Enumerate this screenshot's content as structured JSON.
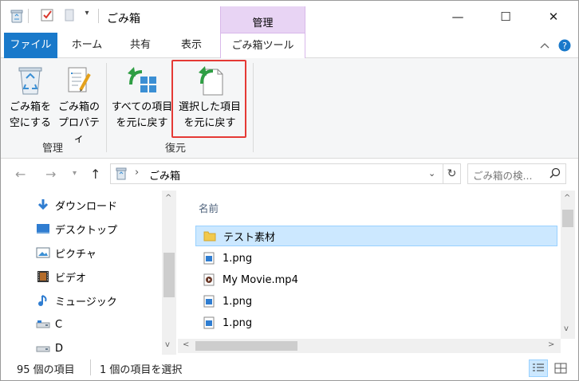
{
  "window": {
    "title": "ごみ箱",
    "context_group": "管理",
    "minimize": "—",
    "maximize": "☐",
    "close": "✕"
  },
  "ribbon_tabs": [
    {
      "label": "ファイル"
    },
    {
      "label": "ホーム"
    },
    {
      "label": "共有"
    },
    {
      "label": "表示"
    },
    {
      "label": "ごみ箱ツール"
    }
  ],
  "ribbon": {
    "groups": [
      {
        "label": "管理",
        "buttons": [
          {
            "line1": "ごみ箱を",
            "line2": "空にする"
          },
          {
            "line1": "ごみ箱の",
            "line2": "プロパティ"
          }
        ]
      },
      {
        "label": "復元",
        "buttons": [
          {
            "line1": "すべての項目",
            "line2": "を元に戻す"
          },
          {
            "line1": "選択した項目",
            "line2": "を元に戻す"
          }
        ]
      }
    ],
    "highlight_color": "#e53935"
  },
  "address": {
    "separator": "›",
    "path": "ごみ箱",
    "search_placeholder": "ごみ箱の検..."
  },
  "nav_pane": {
    "items": [
      {
        "label": "ダウンロード",
        "icon": "download-icon"
      },
      {
        "label": "デスクトップ",
        "icon": "desktop-icon"
      },
      {
        "label": "ピクチャ",
        "icon": "pictures-icon"
      },
      {
        "label": "ビデオ",
        "icon": "videos-icon"
      },
      {
        "label": "ミュージック",
        "icon": "music-icon"
      },
      {
        "label": "C",
        "icon": "drive-icon"
      },
      {
        "label": "D",
        "icon": "drive-icon"
      }
    ]
  },
  "file_list": {
    "column_header": "名前",
    "rows": [
      {
        "name": "テスト素材",
        "type": "folder",
        "selected": true
      },
      {
        "name": "1.png",
        "type": "image",
        "selected": false
      },
      {
        "name": "My Movie.mp4",
        "type": "video",
        "selected": false
      },
      {
        "name": "1.png",
        "type": "image",
        "selected": false
      },
      {
        "name": "1.png",
        "type": "image",
        "selected": false
      }
    ]
  },
  "status_bar": {
    "item_count": "95 個の項目",
    "selection": "1 個の項目を選択"
  },
  "colors": {
    "accent": "#1979ca",
    "context_tab": "#e8d4f4",
    "selection": "#cce8ff"
  }
}
